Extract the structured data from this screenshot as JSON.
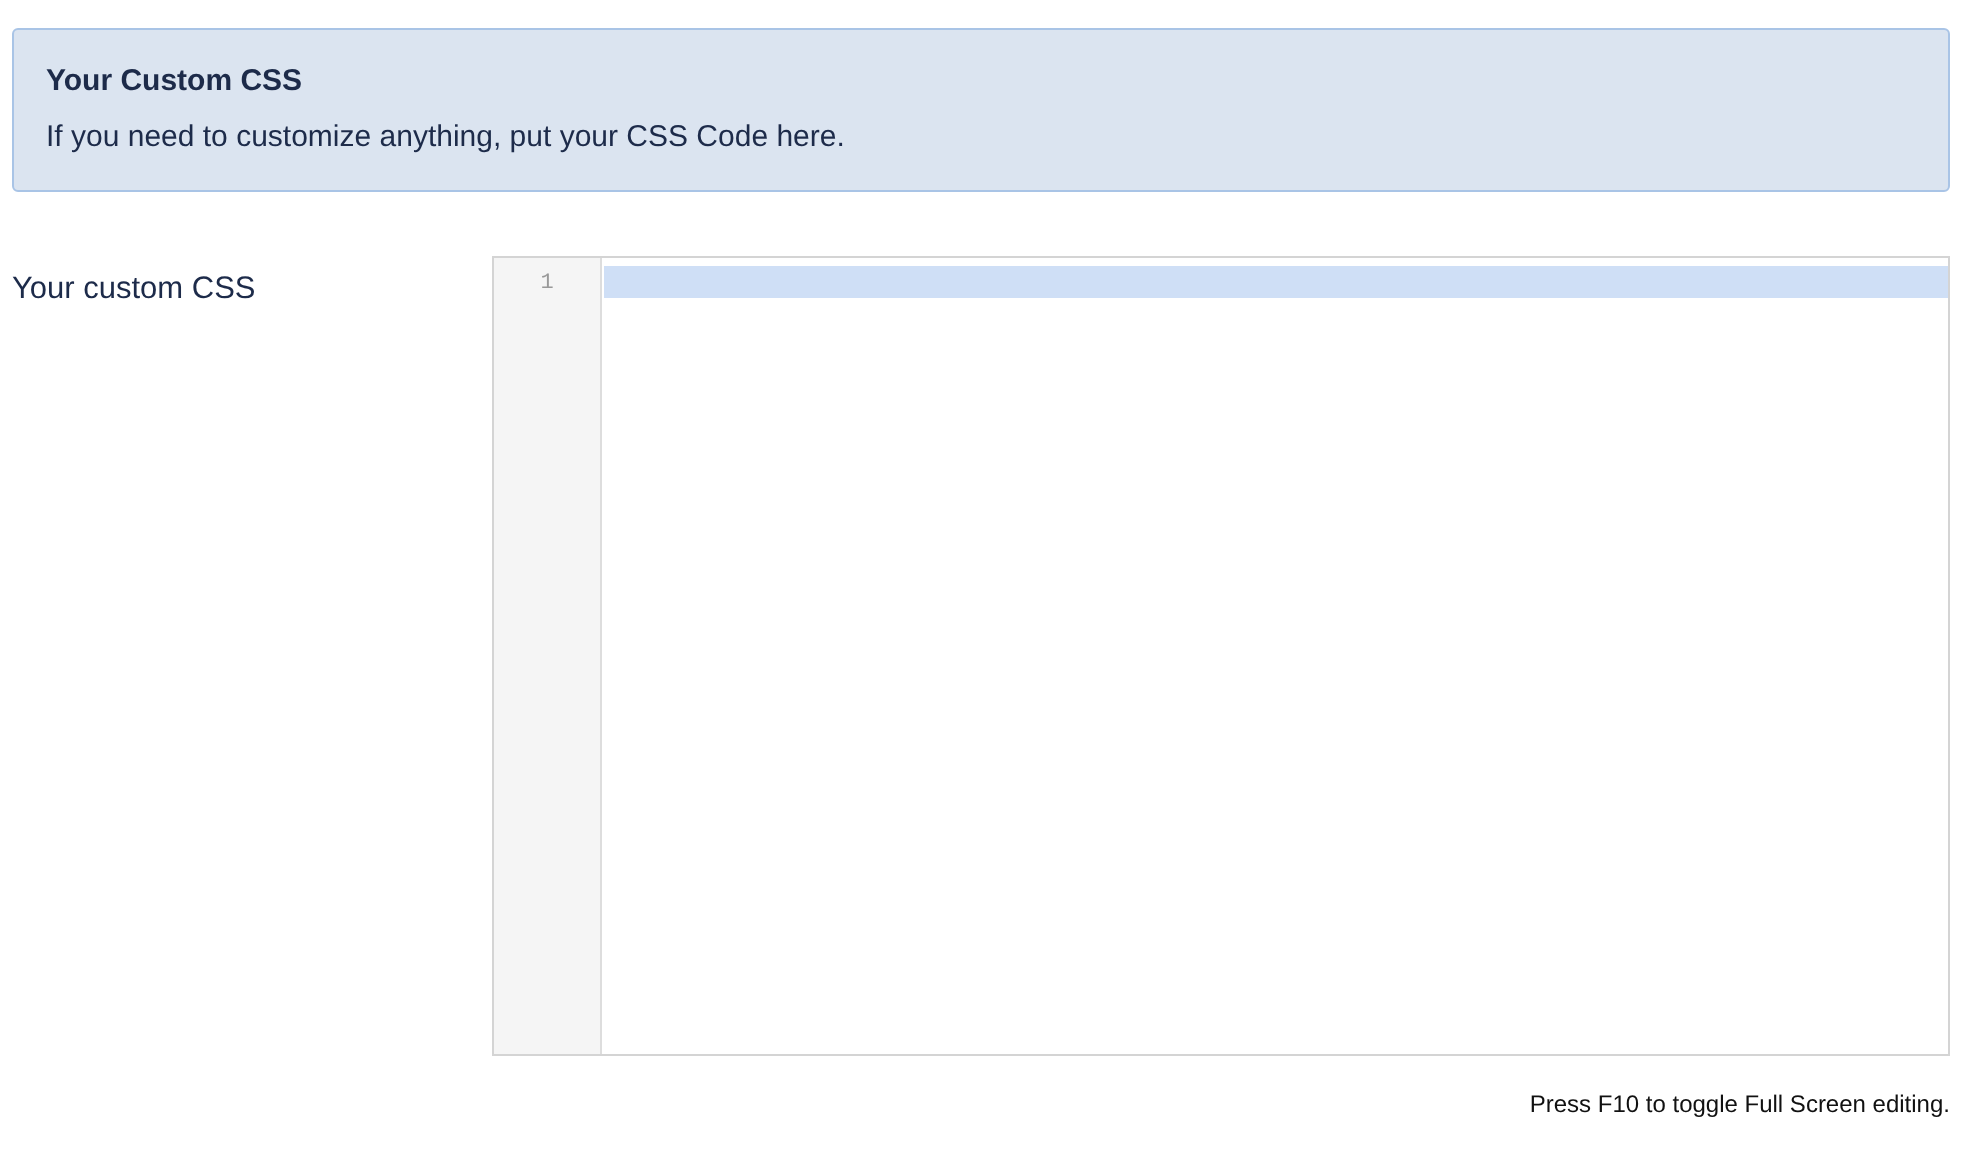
{
  "notice": {
    "title": "Your Custom CSS",
    "text": "If you need to customize anything, put your CSS Code here."
  },
  "field": {
    "label": "Your custom CSS",
    "editor": {
      "lines": [
        {
          "number": "1",
          "active": true
        }
      ]
    }
  },
  "help": "Press F10 to toggle Full Screen editing."
}
